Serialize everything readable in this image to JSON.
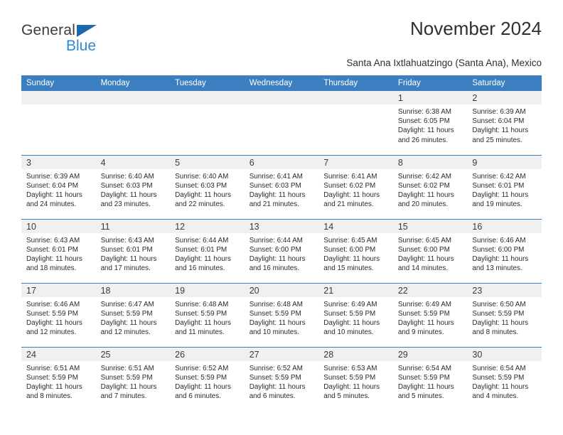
{
  "brand": {
    "name_part1": "General",
    "name_part2": "Blue",
    "accent_color": "#2b8bd6",
    "triangle_color": "#1b6ab0",
    "logo_icon": "blue-triangle-icon"
  },
  "header": {
    "title": "November 2024",
    "subtitle": "Santa Ana Ixtlahuatzingo (Santa Ana), Mexico"
  },
  "calendar": {
    "header_background": "#3c7fc1",
    "daynum_background": "#f0f0f0",
    "weekdays": [
      "Sunday",
      "Monday",
      "Tuesday",
      "Wednesday",
      "Thursday",
      "Friday",
      "Saturday"
    ],
    "weeks": [
      [
        {
          "day": "",
          "empty": true
        },
        {
          "day": "",
          "empty": true
        },
        {
          "day": "",
          "empty": true
        },
        {
          "day": "",
          "empty": true
        },
        {
          "day": "",
          "empty": true
        },
        {
          "day": "1",
          "sunrise": "Sunrise: 6:38 AM",
          "sunset": "Sunset: 6:05 PM",
          "daylight": "Daylight: 11 hours and 26 minutes."
        },
        {
          "day": "2",
          "sunrise": "Sunrise: 6:39 AM",
          "sunset": "Sunset: 6:04 PM",
          "daylight": "Daylight: 11 hours and 25 minutes."
        }
      ],
      [
        {
          "day": "3",
          "sunrise": "Sunrise: 6:39 AM",
          "sunset": "Sunset: 6:04 PM",
          "daylight": "Daylight: 11 hours and 24 minutes."
        },
        {
          "day": "4",
          "sunrise": "Sunrise: 6:40 AM",
          "sunset": "Sunset: 6:03 PM",
          "daylight": "Daylight: 11 hours and 23 minutes."
        },
        {
          "day": "5",
          "sunrise": "Sunrise: 6:40 AM",
          "sunset": "Sunset: 6:03 PM",
          "daylight": "Daylight: 11 hours and 22 minutes."
        },
        {
          "day": "6",
          "sunrise": "Sunrise: 6:41 AM",
          "sunset": "Sunset: 6:03 PM",
          "daylight": "Daylight: 11 hours and 21 minutes."
        },
        {
          "day": "7",
          "sunrise": "Sunrise: 6:41 AM",
          "sunset": "Sunset: 6:02 PM",
          "daylight": "Daylight: 11 hours and 21 minutes."
        },
        {
          "day": "8",
          "sunrise": "Sunrise: 6:42 AM",
          "sunset": "Sunset: 6:02 PM",
          "daylight": "Daylight: 11 hours and 20 minutes."
        },
        {
          "day": "9",
          "sunrise": "Sunrise: 6:42 AM",
          "sunset": "Sunset: 6:01 PM",
          "daylight": "Daylight: 11 hours and 19 minutes."
        }
      ],
      [
        {
          "day": "10",
          "sunrise": "Sunrise: 6:43 AM",
          "sunset": "Sunset: 6:01 PM",
          "daylight": "Daylight: 11 hours and 18 minutes."
        },
        {
          "day": "11",
          "sunrise": "Sunrise: 6:43 AM",
          "sunset": "Sunset: 6:01 PM",
          "daylight": "Daylight: 11 hours and 17 minutes."
        },
        {
          "day": "12",
          "sunrise": "Sunrise: 6:44 AM",
          "sunset": "Sunset: 6:01 PM",
          "daylight": "Daylight: 11 hours and 16 minutes."
        },
        {
          "day": "13",
          "sunrise": "Sunrise: 6:44 AM",
          "sunset": "Sunset: 6:00 PM",
          "daylight": "Daylight: 11 hours and 16 minutes."
        },
        {
          "day": "14",
          "sunrise": "Sunrise: 6:45 AM",
          "sunset": "Sunset: 6:00 PM",
          "daylight": "Daylight: 11 hours and 15 minutes."
        },
        {
          "day": "15",
          "sunrise": "Sunrise: 6:45 AM",
          "sunset": "Sunset: 6:00 PM",
          "daylight": "Daylight: 11 hours and 14 minutes."
        },
        {
          "day": "16",
          "sunrise": "Sunrise: 6:46 AM",
          "sunset": "Sunset: 6:00 PM",
          "daylight": "Daylight: 11 hours and 13 minutes."
        }
      ],
      [
        {
          "day": "17",
          "sunrise": "Sunrise: 6:46 AM",
          "sunset": "Sunset: 5:59 PM",
          "daylight": "Daylight: 11 hours and 12 minutes."
        },
        {
          "day": "18",
          "sunrise": "Sunrise: 6:47 AM",
          "sunset": "Sunset: 5:59 PM",
          "daylight": "Daylight: 11 hours and 12 minutes."
        },
        {
          "day": "19",
          "sunrise": "Sunrise: 6:48 AM",
          "sunset": "Sunset: 5:59 PM",
          "daylight": "Daylight: 11 hours and 11 minutes."
        },
        {
          "day": "20",
          "sunrise": "Sunrise: 6:48 AM",
          "sunset": "Sunset: 5:59 PM",
          "daylight": "Daylight: 11 hours and 10 minutes."
        },
        {
          "day": "21",
          "sunrise": "Sunrise: 6:49 AM",
          "sunset": "Sunset: 5:59 PM",
          "daylight": "Daylight: 11 hours and 10 minutes."
        },
        {
          "day": "22",
          "sunrise": "Sunrise: 6:49 AM",
          "sunset": "Sunset: 5:59 PM",
          "daylight": "Daylight: 11 hours and 9 minutes."
        },
        {
          "day": "23",
          "sunrise": "Sunrise: 6:50 AM",
          "sunset": "Sunset: 5:59 PM",
          "daylight": "Daylight: 11 hours and 8 minutes."
        }
      ],
      [
        {
          "day": "24",
          "sunrise": "Sunrise: 6:51 AM",
          "sunset": "Sunset: 5:59 PM",
          "daylight": "Daylight: 11 hours and 8 minutes."
        },
        {
          "day": "25",
          "sunrise": "Sunrise: 6:51 AM",
          "sunset": "Sunset: 5:59 PM",
          "daylight": "Daylight: 11 hours and 7 minutes."
        },
        {
          "day": "26",
          "sunrise": "Sunrise: 6:52 AM",
          "sunset": "Sunset: 5:59 PM",
          "daylight": "Daylight: 11 hours and 6 minutes."
        },
        {
          "day": "27",
          "sunrise": "Sunrise: 6:52 AM",
          "sunset": "Sunset: 5:59 PM",
          "daylight": "Daylight: 11 hours and 6 minutes."
        },
        {
          "day": "28",
          "sunrise": "Sunrise: 6:53 AM",
          "sunset": "Sunset: 5:59 PM",
          "daylight": "Daylight: 11 hours and 5 minutes."
        },
        {
          "day": "29",
          "sunrise": "Sunrise: 6:54 AM",
          "sunset": "Sunset: 5:59 PM",
          "daylight": "Daylight: 11 hours and 5 minutes."
        },
        {
          "day": "30",
          "sunrise": "Sunrise: 6:54 AM",
          "sunset": "Sunset: 5:59 PM",
          "daylight": "Daylight: 11 hours and 4 minutes."
        }
      ]
    ]
  }
}
